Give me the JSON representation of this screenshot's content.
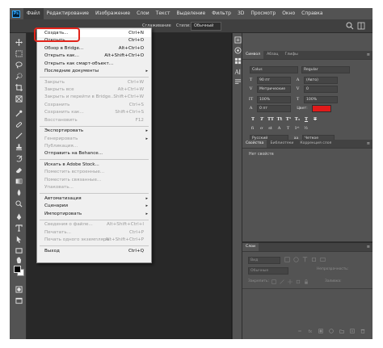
{
  "app": {
    "logo": "Ps",
    "accent": "#31a8ff",
    "highlight_color": "#e2231a"
  },
  "menubar": [
    "Файл",
    "Редактирование",
    "Изображение",
    "Слои",
    "Текст",
    "Выделение",
    "Фильтр",
    "3D",
    "Просмотр",
    "Окно",
    "Справка"
  ],
  "options_bar": {
    "interpolation": "Сглаживание",
    "style_label": "Стили:",
    "style_value": "Обычный"
  },
  "file_menu": {
    "items": [
      {
        "label": "Создать...",
        "shortcut": "Ctrl+N",
        "enabled": true
      },
      {
        "label": "Открыть...",
        "shortcut": "Ctrl+O",
        "enabled": true
      },
      {
        "label": "Обзор в Bridge...",
        "shortcut": "Alt+Ctrl+O",
        "enabled": true
      },
      {
        "label": "Открыть как...",
        "shortcut": "Alt+Shift+Ctrl+O",
        "enabled": true
      },
      {
        "label": "Открыть как смарт-объект...",
        "shortcut": "",
        "enabled": true
      },
      {
        "label": "Последние документы",
        "shortcut": "",
        "enabled": true,
        "submenu": true
      },
      {
        "label": "Закрыть",
        "shortcut": "Ctrl+W",
        "enabled": false
      },
      {
        "label": "Закрыть все",
        "shortcut": "Alt+Ctrl+W",
        "enabled": false
      },
      {
        "label": "Закрыть и перейти в Bridge...",
        "shortcut": "Shift+Ctrl+W",
        "enabled": false
      },
      {
        "label": "Сохранить",
        "shortcut": "Ctrl+S",
        "enabled": false
      },
      {
        "label": "Сохранить как...",
        "shortcut": "Shift+Ctrl+S",
        "enabled": false
      },
      {
        "label": "Восстановить",
        "shortcut": "F12",
        "enabled": false
      },
      {
        "label": "Экспортировать",
        "shortcut": "",
        "enabled": true,
        "submenu": true
      },
      {
        "label": "Генерировать",
        "shortcut": "",
        "enabled": false,
        "submenu": true
      },
      {
        "label": "Публикация...",
        "shortcut": "",
        "enabled": false
      },
      {
        "label": "Отправить на Behance...",
        "shortcut": "",
        "enabled": true
      },
      {
        "label": "Искать в Adobe Stock...",
        "shortcut": "",
        "enabled": true
      },
      {
        "label": "Поместить встроенные...",
        "shortcut": "",
        "enabled": false
      },
      {
        "label": "Поместить связанные...",
        "shortcut": "",
        "enabled": false
      },
      {
        "label": "Упаковать...",
        "shortcut": "",
        "enabled": false
      },
      {
        "label": "Автоматизация",
        "shortcut": "",
        "enabled": true,
        "submenu": true
      },
      {
        "label": "Сценарии",
        "shortcut": "",
        "enabled": true,
        "submenu": true
      },
      {
        "label": "Импортировать",
        "shortcut": "",
        "enabled": true,
        "submenu": true
      },
      {
        "label": "Сведения о файле...",
        "shortcut": "Alt+Shift+Ctrl+I",
        "enabled": false
      },
      {
        "label": "Печатать...",
        "shortcut": "Ctrl+P",
        "enabled": false
      },
      {
        "label": "Печать одного экземпляра",
        "shortcut": "Alt+Shift+Ctrl+P",
        "enabled": false
      },
      {
        "label": "Выход",
        "shortcut": "Ctrl+Q",
        "enabled": true
      }
    ]
  },
  "character_panel": {
    "tabs": [
      "Символ",
      "Абзац",
      "Глифы"
    ],
    "font_family": "Colus",
    "font_style": "Regular",
    "font_size": "90 пт",
    "leading": "(Авто)",
    "kerning": "Метрические",
    "tracking": "0",
    "vscale": "100%",
    "hscale": "100%",
    "baseline": "0 пт",
    "color_label": "Цвет:",
    "color_value": "#e11a1a",
    "style_buttons": [
      "T",
      "T",
      "TT",
      "Tt",
      "T¹",
      "T₁",
      "T",
      "T"
    ],
    "language": "Русский",
    "antialias": "Четкое"
  },
  "properties_panel": {
    "tabs": [
      "Свойства",
      "Библиотеки",
      "Коррекция слоя"
    ],
    "empty_text": "Нет свойств"
  },
  "layers_panel": {
    "tabs": [
      "Слои"
    ],
    "filter_label": "Вид",
    "blend_mode": "Обычные",
    "opacity_label": "Непрозрачность:",
    "lock_label": "Закрепить:",
    "fill_label": "Заливка:"
  }
}
